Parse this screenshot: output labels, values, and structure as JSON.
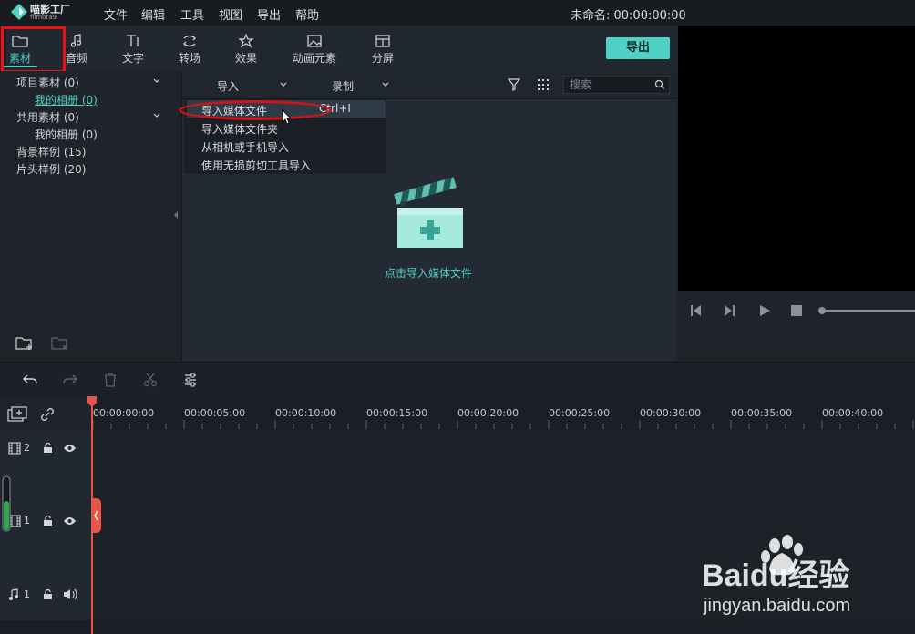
{
  "app": {
    "logo_name": "喵影工厂",
    "logo_sub": "filmora9",
    "menu": [
      "文件",
      "编辑",
      "工具",
      "视图",
      "导出",
      "帮助"
    ],
    "project_title": "未命名: 00:00:00:00"
  },
  "tabs": [
    {
      "label": "素材",
      "icon": "folder-icon",
      "active": true
    },
    {
      "label": "音频",
      "icon": "music-note-icon"
    },
    {
      "label": "文字",
      "icon": "text-icon"
    },
    {
      "label": "转场",
      "icon": "transition-icon"
    },
    {
      "label": "效果",
      "icon": "effects-icon"
    },
    {
      "label": "动画元素",
      "icon": "image-icon"
    },
    {
      "label": "分屏",
      "icon": "split-screen-icon"
    }
  ],
  "export_label": "导出",
  "library": {
    "items": [
      {
        "label": "项目素材 (0)",
        "expandable": true
      },
      {
        "label": "我的相册 (0)",
        "sub": true,
        "selected": true
      },
      {
        "label": "共用素材 (0)",
        "expandable": true
      },
      {
        "label": "我的相册 (0)",
        "sub": true
      },
      {
        "label": "背景样例 (15)"
      },
      {
        "label": "片头样例 (20)"
      }
    ]
  },
  "media_toolbar": {
    "import_label": "导入",
    "record_label": "录制",
    "search_placeholder": "搜索"
  },
  "import_menu": {
    "items": [
      "导入媒体文件",
      "导入媒体文件夹",
      "从相机或手机导入",
      "使用无损剪切工具导入"
    ],
    "shortcut": "Ctrl+I"
  },
  "import_hint": "点击导入媒体文件",
  "timeline": {
    "ticks": [
      "00:00:00:00",
      "00:00:05:00",
      "00:00:10:00",
      "00:00:15:00",
      "00:00:20:00",
      "00:00:25:00",
      "00:00:30:00",
      "00:00:35:00",
      "00:00:40:00"
    ],
    "tracks": [
      {
        "type": "video",
        "number": "2"
      },
      {
        "type": "video",
        "number": "1"
      },
      {
        "type": "audio",
        "number": "1"
      }
    ]
  },
  "watermark": {
    "brand": "Baidu经验",
    "url": "jingyan.baidu.com"
  },
  "colors": {
    "accent": "#4fd1c5",
    "annotation": "#e11111",
    "playhead": "#e8544a"
  }
}
